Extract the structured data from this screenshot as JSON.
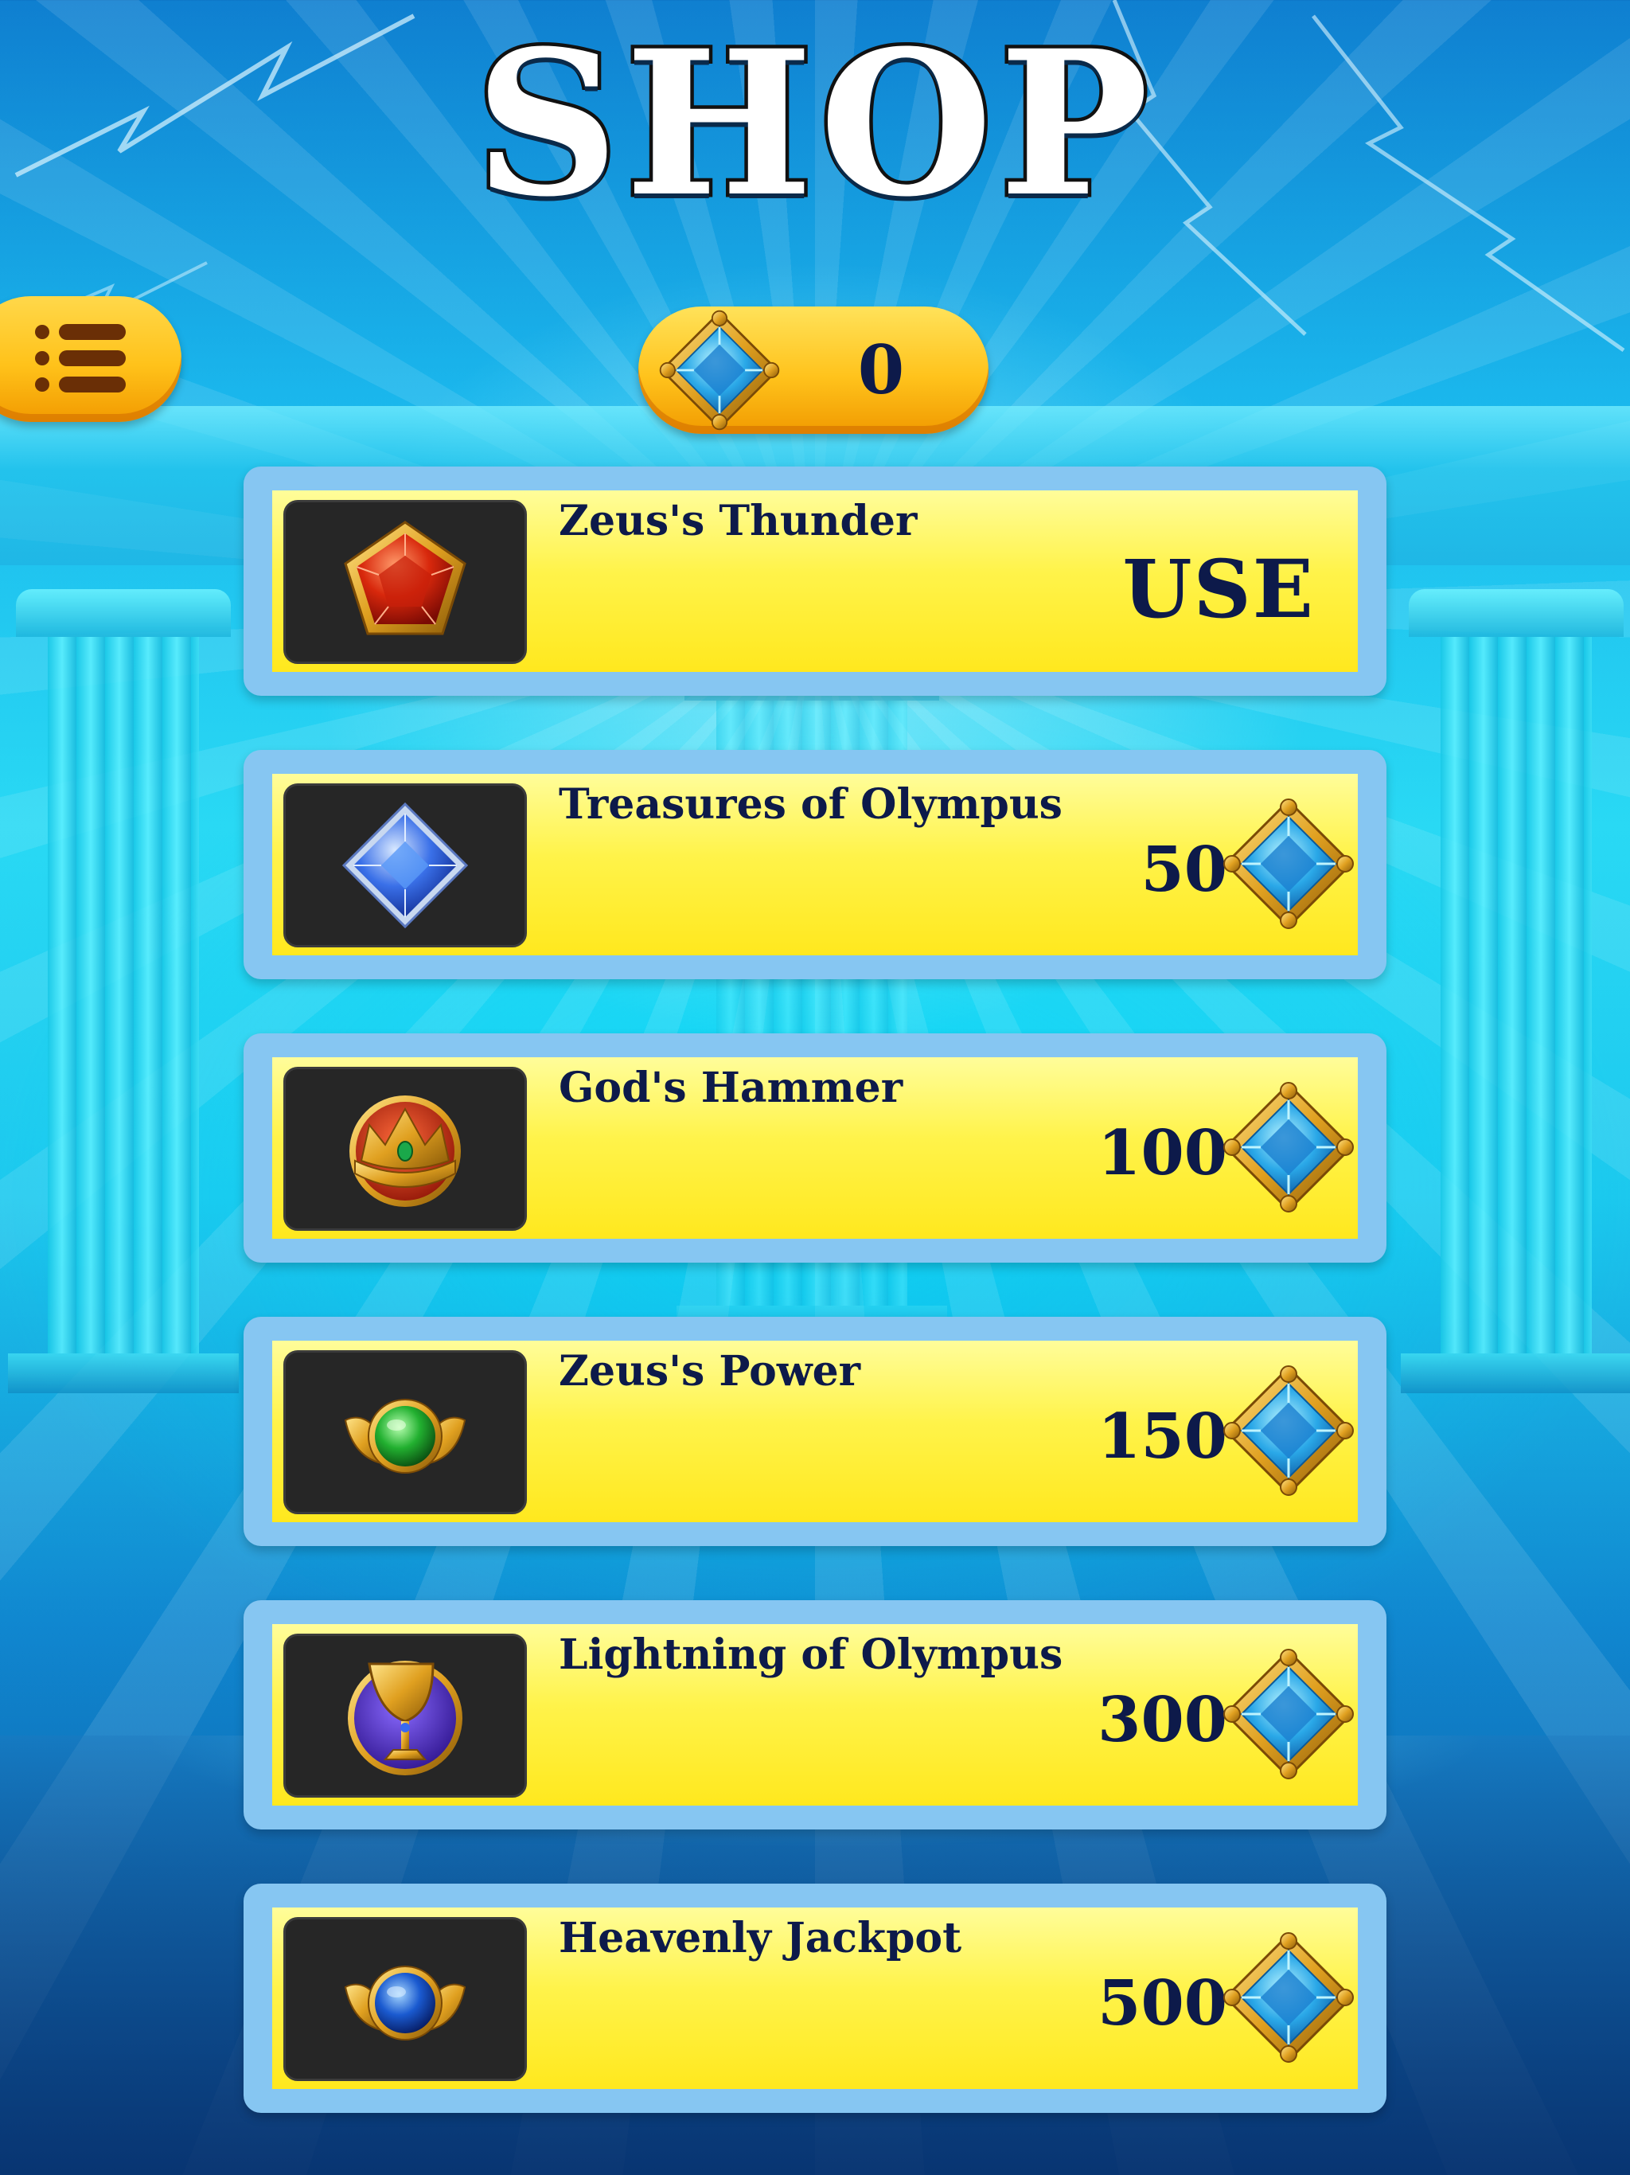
{
  "title": "SHOP",
  "menu": {
    "icon": "list-menu-icon"
  },
  "currency": {
    "icon": "blue-gem-icon",
    "value": "0"
  },
  "items": [
    {
      "name": "Zeus's Thunder",
      "icon": "red-gem-icon",
      "action": "USE"
    },
    {
      "name": "Treasures of Olympus",
      "icon": "blue-diamond-icon",
      "price": "50"
    },
    {
      "name": "God's Hammer",
      "icon": "golden-crown-icon",
      "price": "100"
    },
    {
      "name": "Zeus's Power",
      "icon": "green-winged-orb-icon",
      "price": "150"
    },
    {
      "name": "Lightning of Olympus",
      "icon": "golden-chalice-icon",
      "price": "300"
    },
    {
      "name": "Heavenly Jackpot",
      "icon": "blue-winged-orb-icon",
      "price": "500"
    }
  ],
  "colors": {
    "accent_yellow": "#fff34a",
    "pill_orange": "#ffc21a",
    "text_navy": "#0d1a4a",
    "frame_blue": "#86c6f2"
  }
}
